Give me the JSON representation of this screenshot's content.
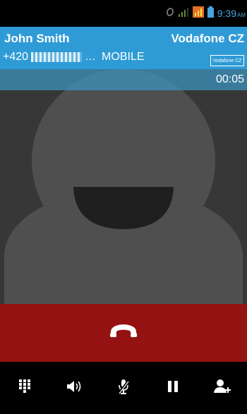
{
  "status_bar": {
    "time": "9:39",
    "ampm": "AM",
    "icons": [
      "sync-icon",
      "signal-icon",
      "mobile-data-icon",
      "battery-icon"
    ]
  },
  "caller": {
    "name": "John Smith",
    "number_prefix": "+420",
    "number_type": "MOBILE",
    "carrier": "Vodafone CZ",
    "carrier_logo_text": "Vodafone CZ"
  },
  "call": {
    "duration": "00:05"
  },
  "actions": [
    {
      "name": "dialpad",
      "icon": "dialpad-icon"
    },
    {
      "name": "speaker",
      "icon": "speaker-icon"
    },
    {
      "name": "mute",
      "icon": "mute-mic-icon"
    },
    {
      "name": "hold",
      "icon": "pause-icon"
    },
    {
      "name": "add-call",
      "icon": "add-person-icon"
    }
  ],
  "colors": {
    "caller_bar": "#2f9bd6",
    "end_call": "#951212",
    "photo_background": "#373737",
    "status_time": "#4aa3df"
  }
}
